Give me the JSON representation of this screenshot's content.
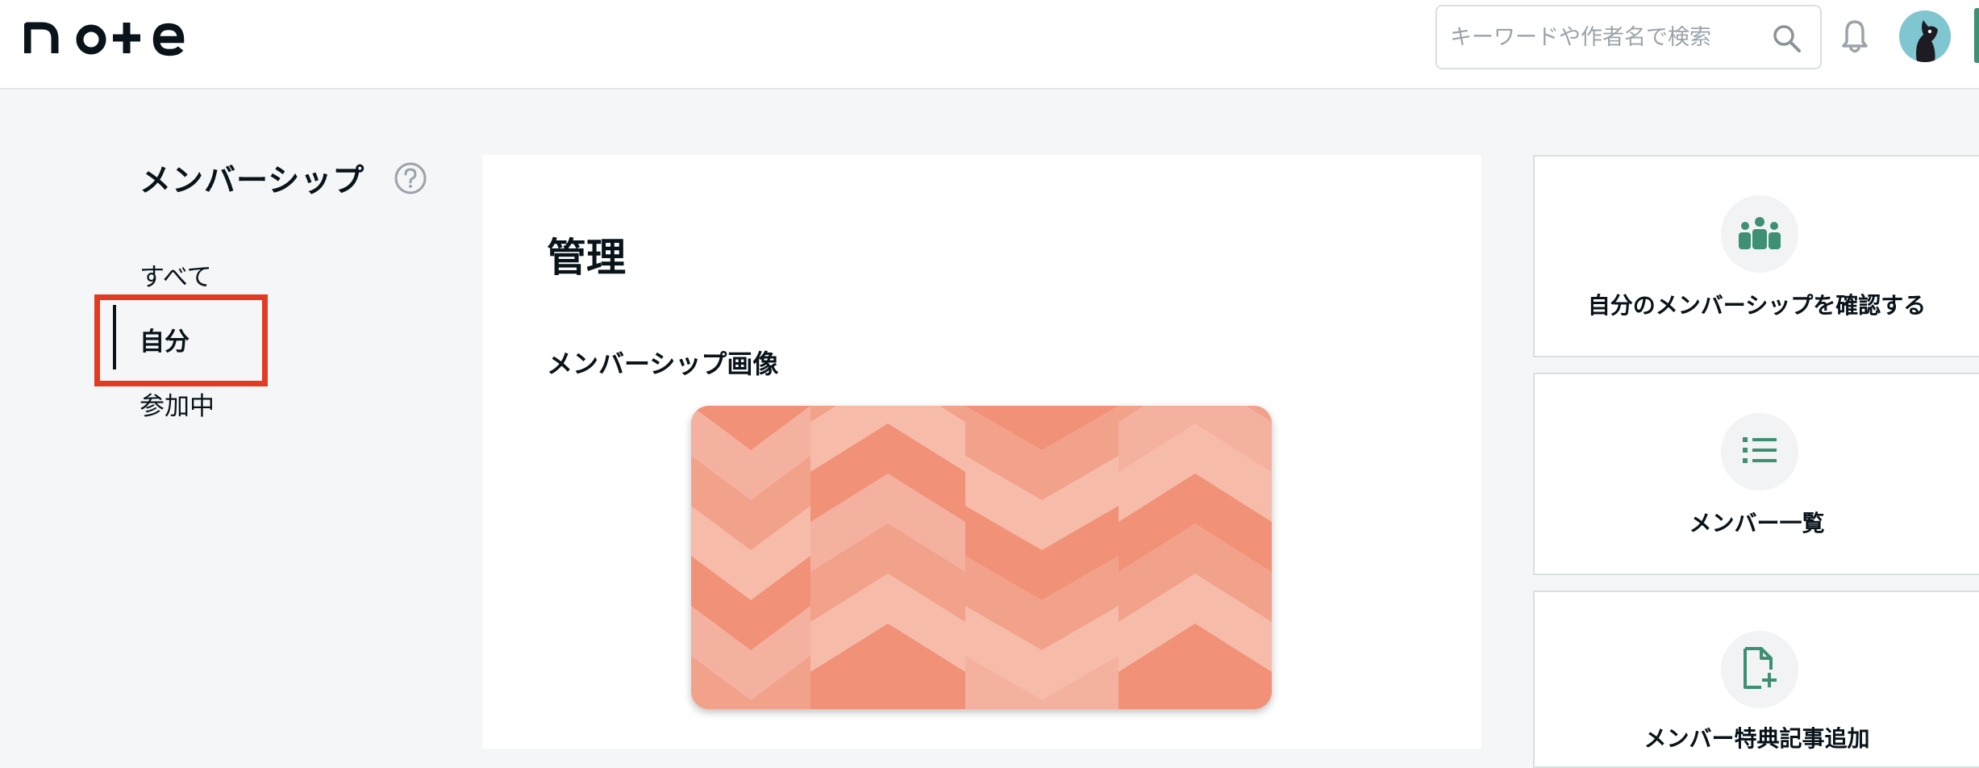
{
  "header": {
    "logo_text": "note",
    "search": {
      "placeholder": "キーワードや作者名で検索",
      "value": ""
    },
    "icons": [
      "search-icon",
      "bell-icon",
      "avatar"
    ]
  },
  "sidebar": {
    "title": "メンバーシップ",
    "help_icon": "question-circle-icon",
    "items": [
      {
        "label": "すべて",
        "active": false
      },
      {
        "label": "自分",
        "active": true
      },
      {
        "label": "参加中",
        "active": false
      }
    ],
    "highlight_color": "#e33a22"
  },
  "main": {
    "title": "管理",
    "image_section_label": "メンバーシップ画像"
  },
  "actions": [
    {
      "label": "自分のメンバーシップを確認する",
      "icon": "group-icon"
    },
    {
      "label": "メンバー一覧",
      "icon": "list-icon"
    },
    {
      "label": "メンバー特典記事追加",
      "icon": "add-document-icon"
    }
  ],
  "colors": {
    "accent_green": "#3e8f73",
    "text": "#08131a",
    "background": "#f5f6f8",
    "membership_image_palette": [
      "#f19278",
      "#f2a28b",
      "#f4b19f",
      "#f6bca9"
    ]
  }
}
